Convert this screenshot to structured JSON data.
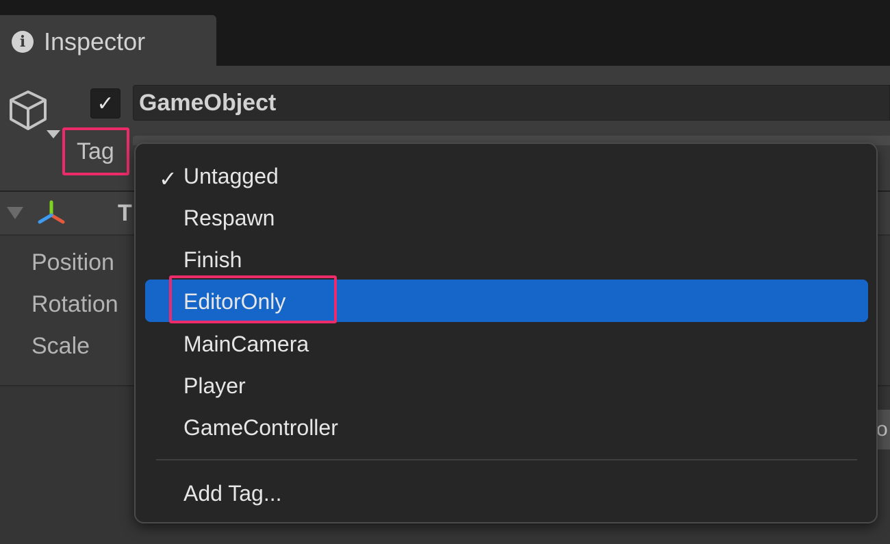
{
  "tab": {
    "title": "Inspector",
    "icon": "info-icon"
  },
  "object": {
    "name": "GameObject",
    "active": true,
    "icon": "cube-icon"
  },
  "tag": {
    "label": "Tag"
  },
  "transform": {
    "title_visible": "T",
    "icon": "transform-axis-icon"
  },
  "properties": [
    {
      "label": "Position"
    },
    {
      "label": "Rotation"
    },
    {
      "label": "Scale"
    }
  ],
  "dropdown": {
    "checked_item": "Untagged",
    "highlighted_item": "EditorOnly",
    "items": [
      {
        "label": "Untagged"
      },
      {
        "label": "Respawn"
      },
      {
        "label": "Finish"
      },
      {
        "label": "EditorOnly"
      },
      {
        "label": "MainCamera"
      },
      {
        "label": "Player"
      },
      {
        "label": "GameController"
      }
    ],
    "footer": "Add Tag..."
  },
  "colors": {
    "selection": "#1566c8",
    "highlight_outline": "#ec2c6a",
    "axis_x": "#e55a3c",
    "axis_y": "#7ed321",
    "axis_z": "#3f9bf0"
  }
}
